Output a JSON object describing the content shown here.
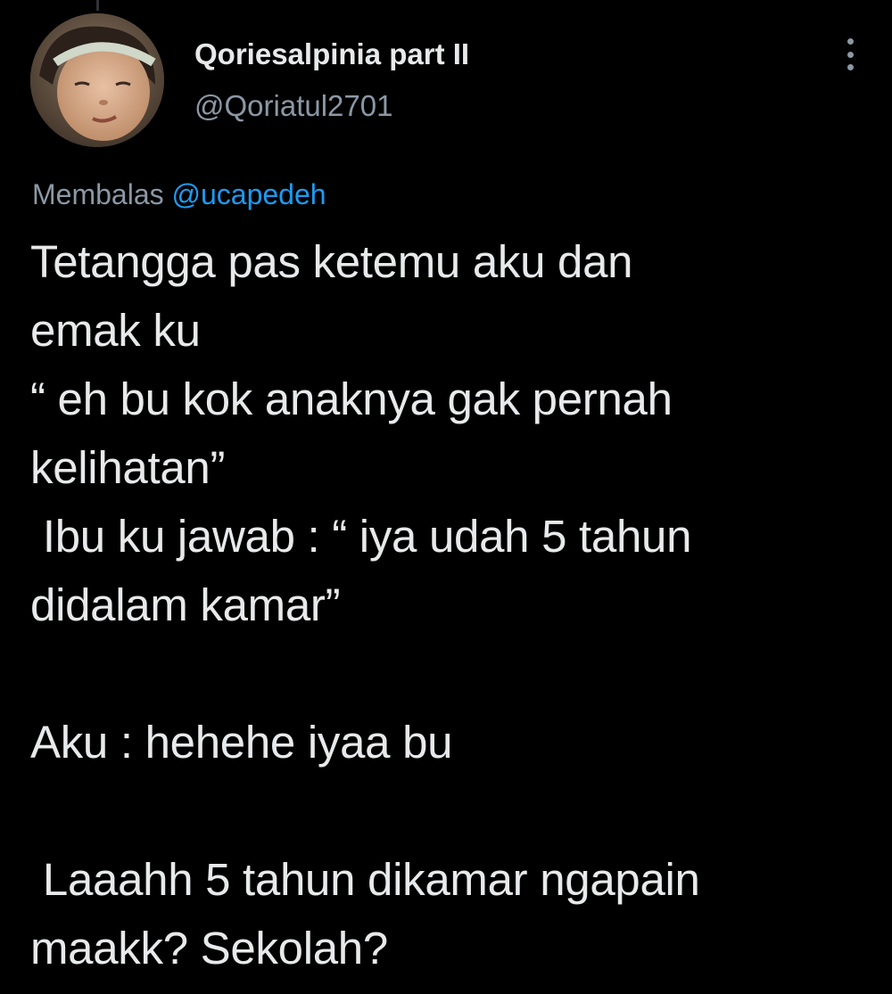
{
  "tweet": {
    "author": {
      "display_name": "Qoriesalpinia part II",
      "handle": "@Qoriatul2701",
      "avatar_icon": "avatar-photo-child"
    },
    "more_icon": "more-vertical-icon",
    "reply_context": {
      "prefix": "Membalas",
      "handle": "@ucapedeh"
    },
    "text": "Tetangga pas ketemu aku dan\nemak ku\n“ eh bu kok anaknya gak pernah\nkelihatan”\n Ibu ku jawab : “ iya udah 5 tahun\ndidalam kamar”\n\nAku : hehehe iyaa bu\n\n Laaahh 5 tahun dikamar ngapain\nmaakk? Sekolah?"
  },
  "colors": {
    "background": "#000000",
    "primary_text": "#e7e9ea",
    "secondary_text": "#8b98a5",
    "link": "#1d9bf0"
  }
}
